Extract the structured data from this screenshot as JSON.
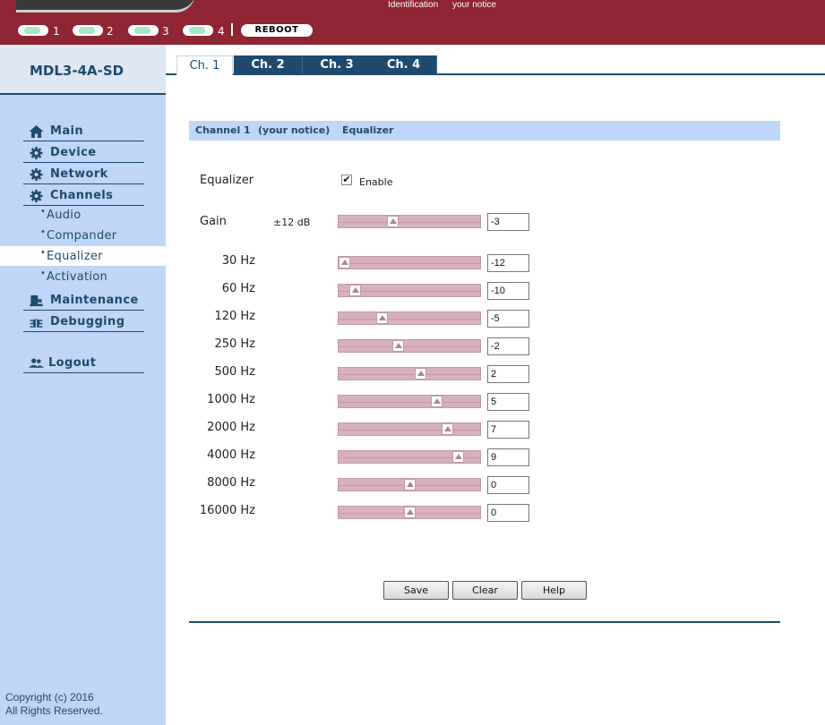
{
  "header": {
    "identification": "Identification",
    "notice": "your notice",
    "leds": [
      "1",
      "2",
      "3",
      "4"
    ],
    "reboot_label": "REBOOT"
  },
  "sidebar": {
    "device_name": "MDL3-4A-SD",
    "nav": [
      {
        "label": "Main",
        "icon": "home-icon"
      },
      {
        "label": "Device",
        "icon": "gear-icon"
      },
      {
        "label": "Network",
        "icon": "gear-icon"
      },
      {
        "label": "Channels",
        "icon": "gear-icon"
      }
    ],
    "subnav": [
      "Audio",
      "Compander",
      "Equalizer",
      "Activation"
    ],
    "active_sub": "Equalizer",
    "nav2": [
      {
        "label": "Maintenance",
        "icon": "wrench-icon"
      },
      {
        "label": "Debugging",
        "icon": "bug-icon"
      }
    ],
    "logout": "Logout",
    "copyright_line1": "Copyright (c) 2016",
    "copyright_line2": "All Rights Reserved."
  },
  "tabs": [
    "Ch. 1",
    "Ch. 2",
    "Ch. 3",
    "Ch. 4"
  ],
  "active_tab": "Ch. 1",
  "page": {
    "title_channel": "Channel 1",
    "title_notice": "(your notice)",
    "title_section": "Equalizer",
    "equalizer_label": "Equalizer",
    "enable_label": "Enable",
    "enable_checked": true,
    "gain_label": "Gain",
    "gain_range": "±12 dB",
    "gain_value": "-3",
    "bands": [
      {
        "freq": "30 Hz",
        "value": "-12"
      },
      {
        "freq": "60 Hz",
        "value": "-10"
      },
      {
        "freq": "120 Hz",
        "value": "-5"
      },
      {
        "freq": "250 Hz",
        "value": "-2"
      },
      {
        "freq": "500 Hz",
        "value": "2"
      },
      {
        "freq": "1000 Hz",
        "value": "5"
      },
      {
        "freq": "2000 Hz",
        "value": "7"
      },
      {
        "freq": "4000 Hz",
        "value": "9"
      },
      {
        "freq": "8000 Hz",
        "value": "0"
      },
      {
        "freq": "16000 Hz",
        "value": "0"
      }
    ],
    "buttons": {
      "save": "Save",
      "clear": "Clear",
      "help": "Help"
    }
  },
  "colors": {
    "header_bg": "#8f2433",
    "sidebar_bg": "#bfd6f7",
    "accent": "#1f4a6e",
    "slider": "#d7b1bd"
  }
}
